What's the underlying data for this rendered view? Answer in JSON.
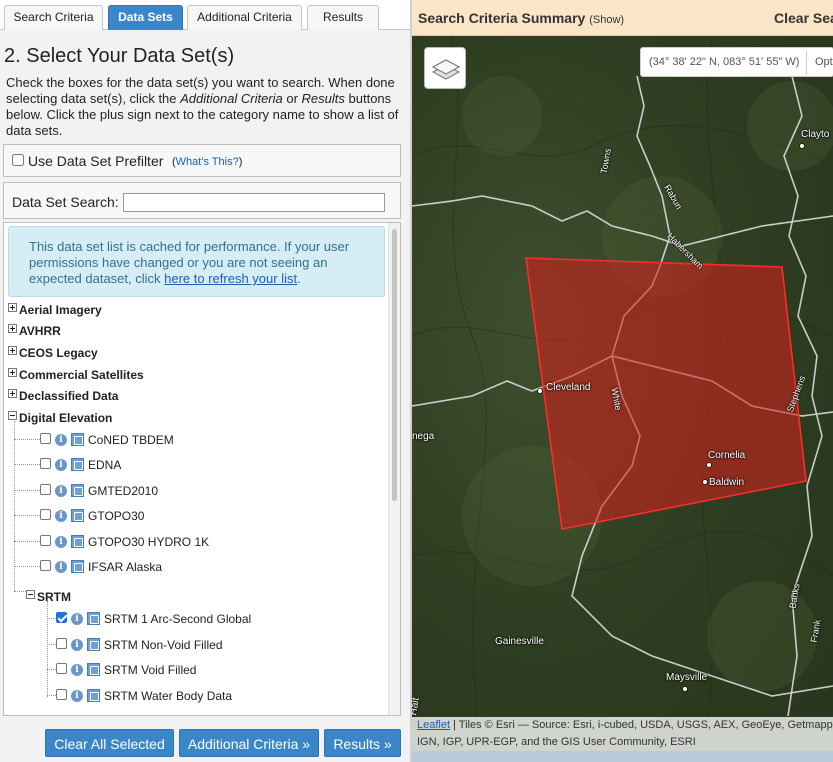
{
  "tabs": [
    {
      "label": "Search Criteria",
      "active": false
    },
    {
      "label": "Data Sets",
      "active": true
    },
    {
      "label": "Additional Criteria",
      "active": false
    },
    {
      "label": "Results",
      "active": false
    }
  ],
  "step_title": "2. Select Your Data Set(s)",
  "intro": {
    "part1": "Check the boxes for the data set(s) you want to search. When done selecting data set(s), click the ",
    "em1": "Additional Criteria",
    "part2": " or ",
    "em2": "Results",
    "part3": " buttons below. Click the plus sign next to the category name to show a list of data sets."
  },
  "prefilter": {
    "label": "Use Data Set Prefilter",
    "help_open": "(",
    "help_link": "What's This?",
    "help_close": ")"
  },
  "dataset_search": {
    "label": "Data Set Search:",
    "value": "",
    "placeholder": ""
  },
  "cache_note": {
    "text": "This data set list is cached for performance. If your user permissions have changed or you are not seeing an expected dataset, click ",
    "link": "here to refresh your list",
    "end": "."
  },
  "categories": [
    {
      "label": "Aerial Imagery",
      "expanded": false
    },
    {
      "label": "AVHRR",
      "expanded": false
    },
    {
      "label": "CEOS Legacy",
      "expanded": false
    },
    {
      "label": "Commercial Satellites",
      "expanded": false
    },
    {
      "label": "Declassified Data",
      "expanded": false
    },
    {
      "label": "Digital Elevation",
      "expanded": true
    }
  ],
  "digital_elevation_items": [
    {
      "label": "CoNED TBDEM",
      "checked": false
    },
    {
      "label": "EDNA",
      "checked": false
    },
    {
      "label": "GMTED2010",
      "checked": false
    },
    {
      "label": "GTOPO30",
      "checked": false
    },
    {
      "label": "GTOPO30 HYDRO 1K",
      "checked": false
    },
    {
      "label": "IFSAR Alaska",
      "checked": false
    }
  ],
  "srtm": {
    "label": "SRTM",
    "expanded": true,
    "items": [
      {
        "label": "SRTM 1 Arc-Second Global",
        "checked": true
      },
      {
        "label": "SRTM Non-Void Filled",
        "checked": false
      },
      {
        "label": "SRTM Void Filled",
        "checked": false
      },
      {
        "label": "SRTM Water Body Data",
        "checked": false
      }
    ]
  },
  "buttons": {
    "clear": "Clear All Selected",
    "additional": "Additional Criteria »",
    "results": "Results »"
  },
  "summary_bar": {
    "title": "Search Criteria Summary",
    "show": "(Show)",
    "clear": "Clear Sea"
  },
  "map": {
    "coord_text": "(34° 38' 22\" N, 083° 51' 55\" W)",
    "options_label": "Opt",
    "places": [
      "Clayto",
      "Cleveland",
      "Cornelia",
      "Baldwin",
      "Gainesville",
      "Maysville",
      "nega",
      "Halt"
    ],
    "roads": [
      "Towns",
      "Rabun",
      "Habersham",
      "White",
      "Stephens",
      "Banks",
      "Frank"
    ],
    "polygon_color": "#ff2a2a",
    "attribution": {
      "link": "Leaflet",
      "line1": " | Tiles © Esri — Source: Esri, i-cubed, USDA, USGS, AEX, GeoEye, Getmapping, Aerogrid,",
      "line2": "IGN, IGP, UPR-EGP, and the GIS User Community, ESRI"
    }
  },
  "colors": {
    "accent": "#3a86c8",
    "summary_bg": "#fbe5c7",
    "note_bg": "#d7edf6"
  }
}
